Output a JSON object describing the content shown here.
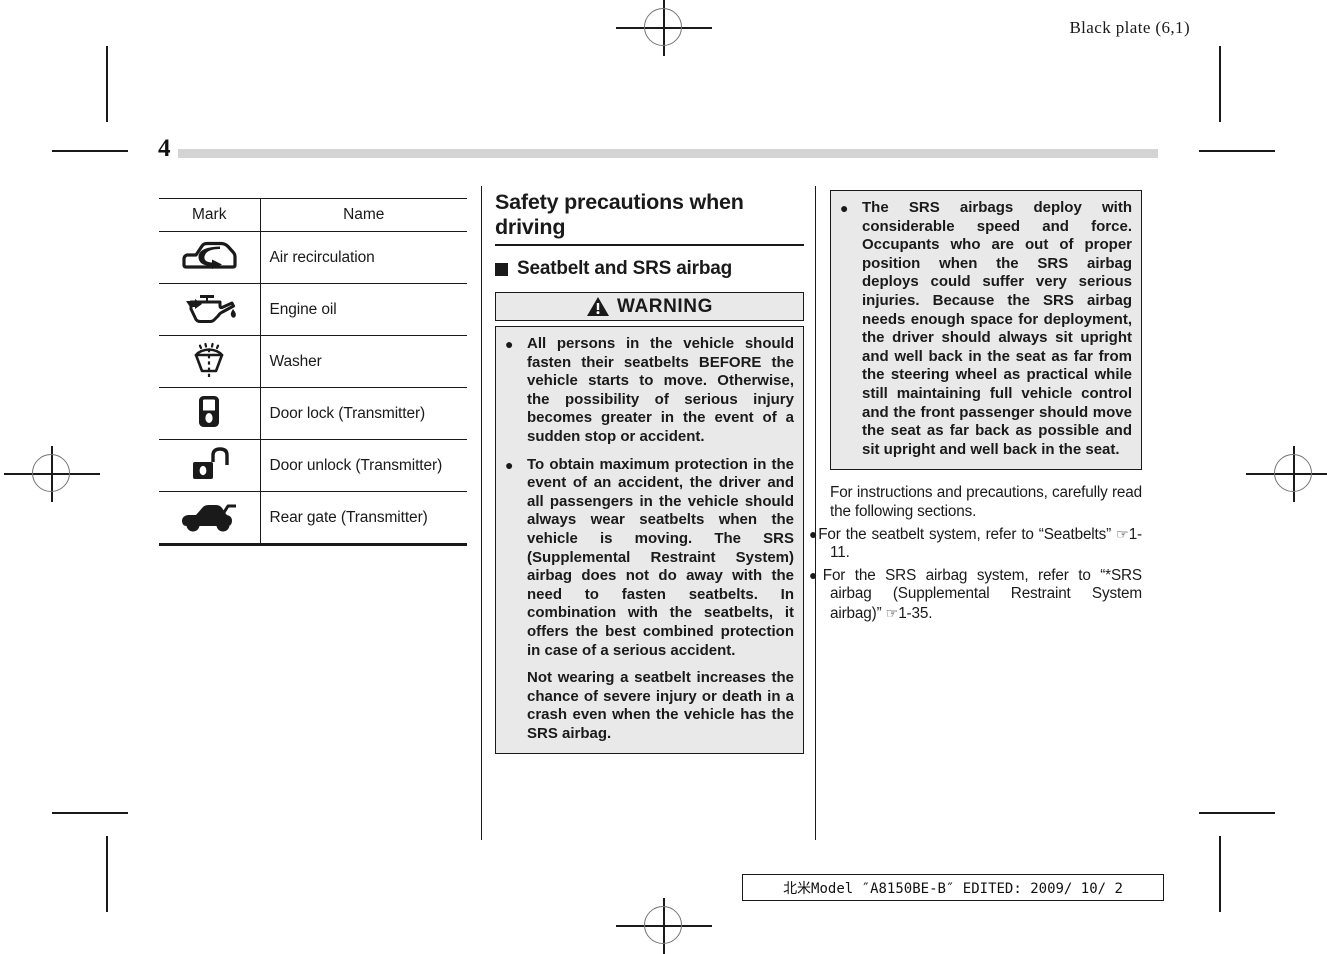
{
  "header": {
    "plate_label": "Black plate (6,1)"
  },
  "page": {
    "number": "4"
  },
  "mark_table": {
    "headers": [
      "Mark",
      "Name"
    ],
    "rows": [
      {
        "icon": "air-recirculation-icon",
        "name": "Air recirculation"
      },
      {
        "icon": "engine-oil-icon",
        "name": "Engine oil"
      },
      {
        "icon": "washer-icon",
        "name": "Washer"
      },
      {
        "icon": "door-lock-icon",
        "name": "Door lock (Transmitter)"
      },
      {
        "icon": "door-unlock-icon",
        "name": "Door unlock (Transmitter)"
      },
      {
        "icon": "rear-gate-icon",
        "name": "Rear gate (Transmitter)"
      }
    ]
  },
  "section": {
    "title": "Safety precautions when driving",
    "subheading": "Seatbelt and SRS airbag",
    "warning_label": "WARNING",
    "warning_icon": "warning-triangle-icon"
  },
  "warning_left": {
    "bullet": "●",
    "items": [
      "All persons in the vehicle should fasten their seatbelts BEFORE the vehicle starts to move. Otherwise, the possibility of serious injury becomes greater in the event of a sudden stop or accident.",
      "To obtain maximum protection in the event of an accident, the driver and all passengers in the vehicle should always wear seatbelts when the vehicle is moving. The SRS (Supplemental Restraint System) airbag does not do away with the need to fasten seatbelts. In combination with the seatbelts, it offers the best combined protection in case of a serious accident."
    ],
    "closing_paragraph": "Not wearing a seatbelt increases the chance of severe injury or death in a crash even when the vehicle has the SRS airbag."
  },
  "warning_right": {
    "bullet": "●",
    "items": [
      "The SRS airbags deploy with considerable speed and force. Occupants who are out of proper position when the SRS airbag deploys could suffer very serious injuries. Because the SRS airbag needs enough space for deployment, the driver should always sit upright and well back in the seat as far from the steering wheel as practical while still maintaining full vehicle control and the front passenger should move the seat as far back as possible and sit upright and well back in the seat."
    ]
  },
  "notes": {
    "intro": "For instructions and precautions, carefully read the following sections.",
    "bullet": "●",
    "hand_icon": "pointing-hand-icon",
    "hand_glyph": "☞",
    "items": [
      {
        "text_before": "For the seatbelt system, refer to “Seatbelts” ",
        "reference": "1-11."
      },
      {
        "text_before": "For the SRS airbag system, refer to “*SRS airbag (Supplemental Restraint System airbag)” ",
        "reference": "1-35."
      }
    ]
  },
  "footer": {
    "stamp": "北米Model ″A8150BE-B″ EDITED: 2009/ 10/ 2"
  },
  "colors": {
    "page_bar": "#d4d4d4",
    "warning_bg": "#e9e9e9",
    "rule": "#1a1a1a"
  }
}
